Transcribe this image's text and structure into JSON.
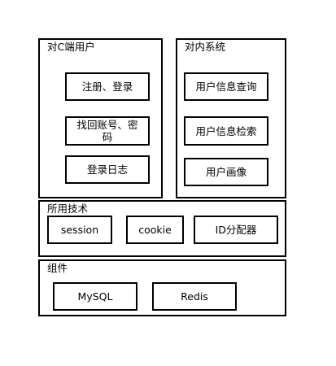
{
  "groups": {
    "consumer": {
      "title": "对C端用户",
      "items": [
        "注册、登录",
        "找回账号、密码",
        "登录日志"
      ]
    },
    "internal": {
      "title": "对内系统",
      "items": [
        "用户信息查询",
        "用户信息检索",
        "用户画像"
      ]
    },
    "tech": {
      "title": "所用技术",
      "items": [
        "session",
        "cookie",
        "ID分配器"
      ]
    },
    "components": {
      "title": "组件",
      "items": [
        "MySQL",
        "Redis"
      ]
    }
  }
}
